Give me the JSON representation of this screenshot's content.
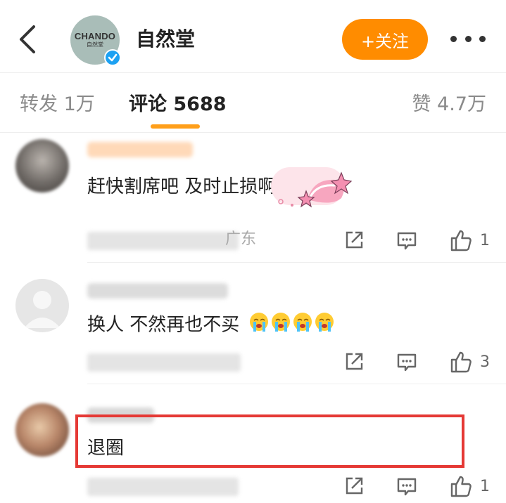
{
  "header": {
    "brand_logo_text": "CHANDO",
    "brand_logo_subtext": "自然堂",
    "title": "自然堂",
    "follow_label": "+关注"
  },
  "tabs": {
    "repost_label": "转发 1万",
    "comment_label": "评论 5688",
    "like_label": "赞 4.7万"
  },
  "comments": [
    {
      "text": "赶快割席吧 及时止损啊",
      "meta": "广东",
      "like_count": "1"
    },
    {
      "text": "换人 不然再也不买",
      "meta": "",
      "like_count": "3"
    },
    {
      "text": "退圈",
      "meta": "",
      "like_count": "1"
    }
  ],
  "colors": {
    "accent": "#ff8c00",
    "tab_underline": "#ff9f1a",
    "highlight": "#e53935",
    "verified": "#1da1f2"
  },
  "icons": [
    "back-arrow-icon",
    "verified-icon",
    "more-icon",
    "share-icon",
    "comment-icon",
    "thumbs-up-icon",
    "sticker-icon",
    "crying-emoji-icon"
  ]
}
